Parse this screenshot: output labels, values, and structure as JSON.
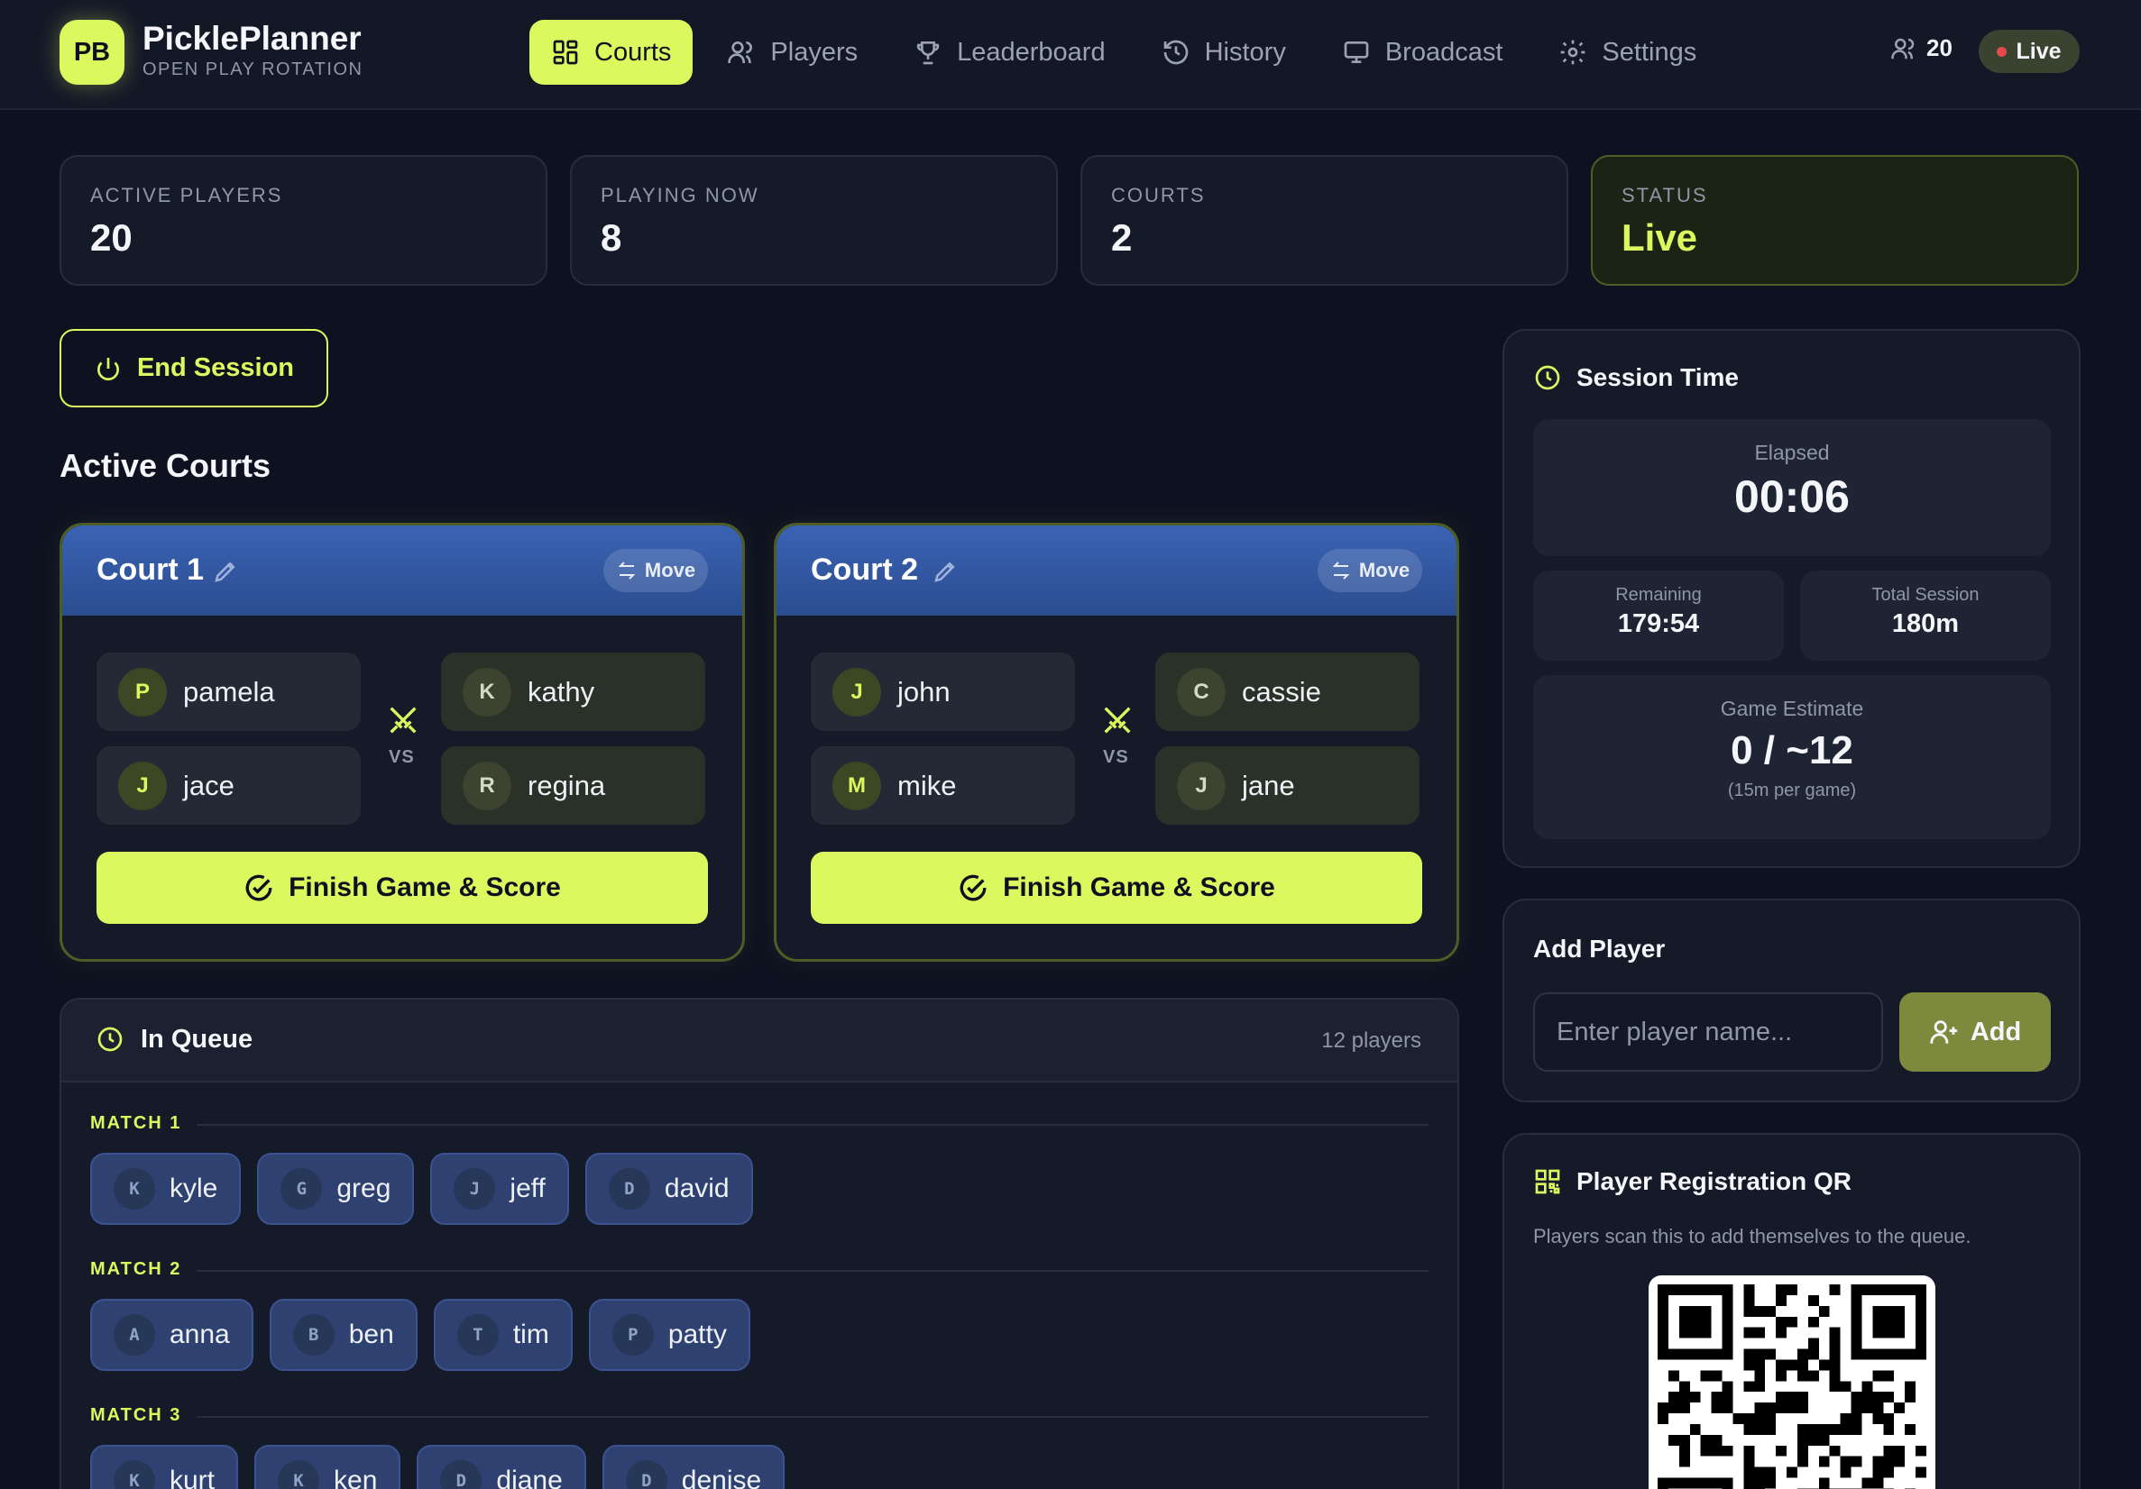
{
  "app": {
    "logo": "PB",
    "name": "PicklePlanner",
    "subtitle": "OPEN PLAY ROTATION"
  },
  "nav": [
    {
      "label": "Courts",
      "icon": "grid-icon",
      "active": true
    },
    {
      "label": "Players",
      "icon": "users-icon"
    },
    {
      "label": "Leaderboard",
      "icon": "trophy-icon"
    },
    {
      "label": "History",
      "icon": "history-icon"
    },
    {
      "label": "Broadcast",
      "icon": "monitor-icon"
    },
    {
      "label": "Settings",
      "icon": "gear-icon"
    }
  ],
  "header": {
    "player_count": "20",
    "live_label": "Live"
  },
  "stats": [
    {
      "label": "ACTIVE PLAYERS",
      "value": "20"
    },
    {
      "label": "PLAYING NOW",
      "value": "8"
    },
    {
      "label": "COURTS",
      "value": "2"
    },
    {
      "label": "STATUS",
      "value": "Live"
    }
  ],
  "end_session_label": "End Session",
  "active_courts_title": "Active Courts",
  "courts": [
    {
      "name": "Court 1",
      "move_label": "Move",
      "vs": "VS",
      "team_a": [
        {
          "initial": "P",
          "name": "pamela"
        },
        {
          "initial": "J",
          "name": "jace"
        }
      ],
      "team_b": [
        {
          "initial": "K",
          "name": "kathy"
        },
        {
          "initial": "R",
          "name": "regina"
        }
      ],
      "finish_label": "Finish Game & Score"
    },
    {
      "name": "Court 2",
      "move_label": "Move",
      "vs": "VS",
      "team_a": [
        {
          "initial": "J",
          "name": "john"
        },
        {
          "initial": "M",
          "name": "mike"
        }
      ],
      "team_b": [
        {
          "initial": "C",
          "name": "cassie"
        },
        {
          "initial": "J",
          "name": "jane"
        }
      ],
      "finish_label": "Finish Game & Score"
    }
  ],
  "queue": {
    "title": "In Queue",
    "count": "12 players",
    "matches": [
      {
        "label": "MATCH 1",
        "players": [
          {
            "initial": "K",
            "name": "kyle"
          },
          {
            "initial": "G",
            "name": "greg"
          },
          {
            "initial": "J",
            "name": "jeff"
          },
          {
            "initial": "D",
            "name": "david"
          }
        ]
      },
      {
        "label": "MATCH 2",
        "players": [
          {
            "initial": "A",
            "name": "anna"
          },
          {
            "initial": "B",
            "name": "ben"
          },
          {
            "initial": "T",
            "name": "tim"
          },
          {
            "initial": "P",
            "name": "patty"
          }
        ]
      },
      {
        "label": "MATCH 3",
        "players": [
          {
            "initial": "K",
            "name": "kurt"
          },
          {
            "initial": "K",
            "name": "ken"
          },
          {
            "initial": "D",
            "name": "diane"
          },
          {
            "initial": "D",
            "name": "denise"
          }
        ]
      }
    ]
  },
  "session_time": {
    "title": "Session Time",
    "elapsed_label": "Elapsed",
    "elapsed": "00:06",
    "remaining_label": "Remaining",
    "remaining": "179:54",
    "total_label": "Total Session",
    "total": "180m",
    "estimate_label": "Game Estimate",
    "estimate": "0 / ~12",
    "estimate_note": "(15m per game)"
  },
  "add_player": {
    "title": "Add Player",
    "placeholder": "Enter player name...",
    "button": "Add"
  },
  "qr": {
    "title": "Player Registration QR",
    "description": "Players scan this to add themselves to the queue."
  },
  "colors": {
    "accent": "#dcf85f",
    "background": "#0e1220",
    "court_header": "#3a63b4",
    "chip": "#2e4170"
  }
}
